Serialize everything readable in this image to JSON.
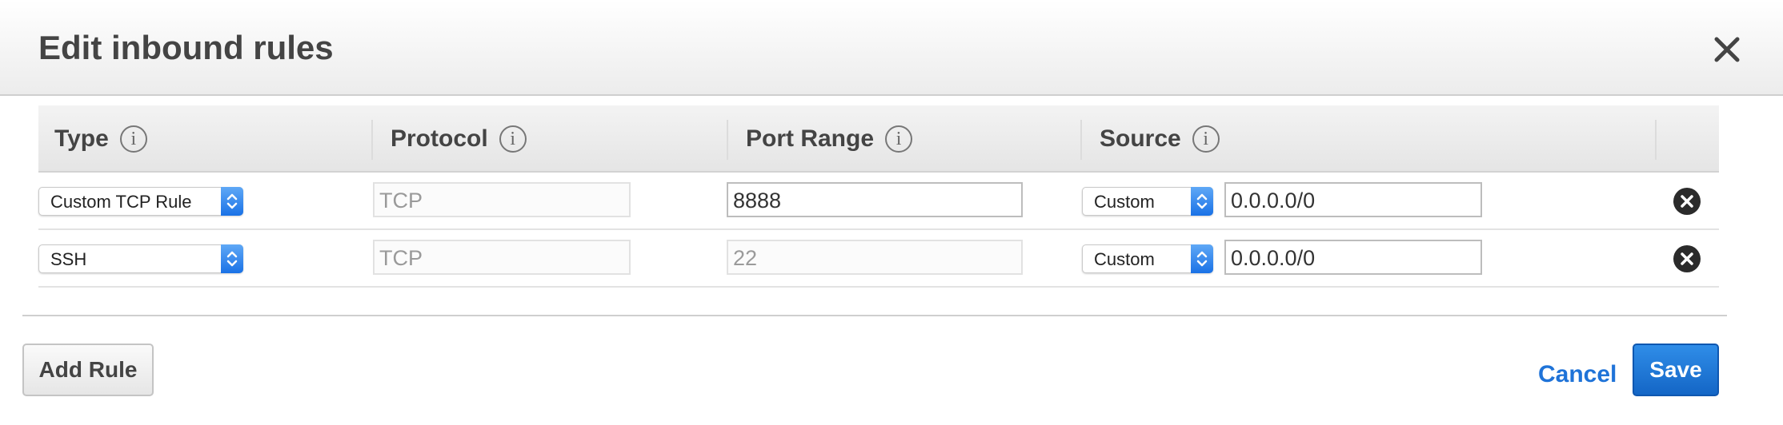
{
  "dialog": {
    "title": "Edit inbound rules"
  },
  "table": {
    "columns": [
      {
        "label": "Type",
        "info": "i"
      },
      {
        "label": "Protocol",
        "info": "i"
      },
      {
        "label": "Port Range",
        "info": "i"
      },
      {
        "label": "Source",
        "info": "i"
      }
    ],
    "rows": [
      {
        "type": "Custom TCP Rule",
        "protocol": "TCP",
        "port": "8888",
        "source_type": "Custom",
        "source_cidr": "0.0.0.0/0"
      },
      {
        "type": "SSH",
        "protocol": "TCP",
        "port": "22",
        "source_type": "Custom",
        "source_cidr": "0.0.0.0/0"
      }
    ]
  },
  "footer": {
    "add_label": "Add Rule",
    "cancel_label": "Cancel",
    "save_label": "Save"
  },
  "colors": {
    "accent": "#1f73d8",
    "save_button": "#1a6fd0",
    "select_arrow": "#2a7ef0"
  },
  "icons": {
    "close": "close-icon",
    "info": "info-icon",
    "remove": "remove-circle-icon",
    "select_arrows": "chevron-up-down-icon"
  }
}
